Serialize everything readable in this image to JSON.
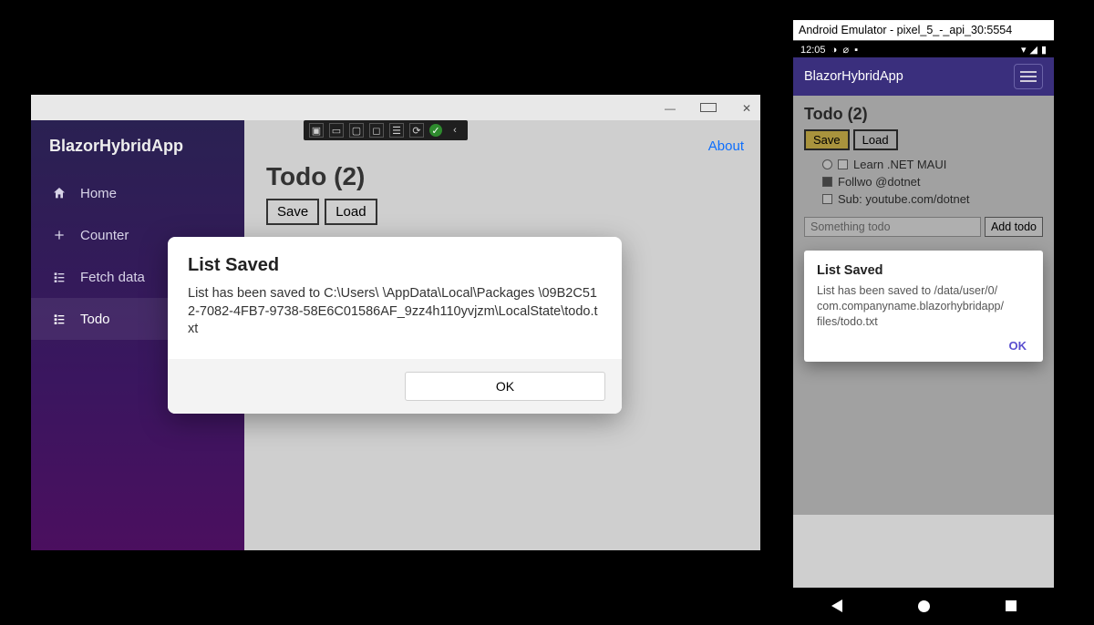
{
  "desktop": {
    "brand": "BlazorHybridApp",
    "nav": {
      "home": "Home",
      "counter": "Counter",
      "fetch": "Fetch data",
      "todo": "Todo"
    },
    "about": "About",
    "todo_heading": "Todo (2)",
    "save_label": "Save",
    "load_label": "Load",
    "dialog": {
      "title": "List Saved",
      "message": "List has been saved to C:\\Users\\        \\AppData\\Local\\Packages \\09B2C512-7082-4FB7-9738-58E6C01586AF_9zz4h110yvjzm\\LocalState\\todo.txt",
      "ok": "OK"
    }
  },
  "android": {
    "emulator_title": "Android Emulator - pixel_5_-_api_30:5554",
    "time": "12:05",
    "appbar_title": "BlazorHybridApp",
    "todo_heading": "Todo (2)",
    "save_label": "Save",
    "load_label": "Load",
    "items": {
      "i0": "Learn .NET MAUI",
      "i1": "Follwo @dotnet",
      "i2": "Sub: youtube.com/dotnet"
    },
    "placeholder": "Something todo",
    "add_label": "Add todo",
    "dialog": {
      "title": "List Saved",
      "message": "List has been saved to /data/user/0/ com.companyname.blazorhybridapp/ files/todo.txt",
      "ok": "OK"
    }
  }
}
